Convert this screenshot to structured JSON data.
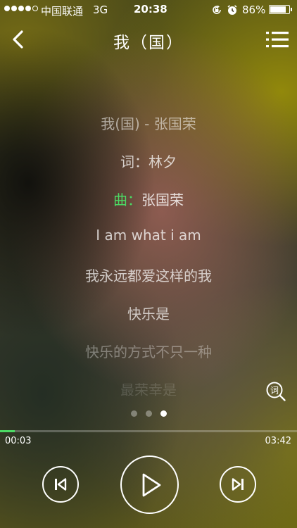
{
  "status_bar": {
    "carrier": "中国联通",
    "network": "3G",
    "time": "20:38",
    "battery_percent": "86%",
    "battery_level": 0.86,
    "icons": [
      "rotation-lock-icon",
      "alarm-icon"
    ]
  },
  "header": {
    "title": "我（国）",
    "back_icon": "chevron-left-icon",
    "menu_icon": "list-menu-icon"
  },
  "lyrics": {
    "lines": [
      "我(国) - 张国荣",
      "词：林夕",
      "曲：",
      "I am what i am",
      "我永远都爱这样的我",
      "快乐是",
      "快乐的方式不只一种",
      "最荣幸是"
    ],
    "composer_name": "张国荣",
    "highlight_color": "#4cd964",
    "search_icon_label": "词"
  },
  "pager": {
    "count": 3,
    "active_index": 2
  },
  "playback": {
    "current_time": "00:03",
    "total_time": "03:42",
    "progress": 0.05,
    "accent_color": "#4cd964"
  },
  "controls": {
    "prev_icon": "skip-previous-icon",
    "play_icon": "play-icon",
    "next_icon": "skip-next-icon"
  }
}
